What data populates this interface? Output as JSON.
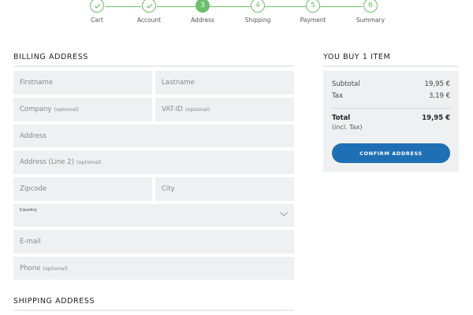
{
  "stepper": {
    "accent_color": "#6cbf6a",
    "steps": [
      {
        "label": "Cart",
        "marker": "",
        "state": "done"
      },
      {
        "label": "Account",
        "marker": "",
        "state": "done"
      },
      {
        "label": "Address",
        "marker": "3",
        "state": "active"
      },
      {
        "label": "Shipping",
        "marker": "4",
        "state": "upcoming"
      },
      {
        "label": "Payment",
        "marker": "5",
        "state": "upcoming"
      },
      {
        "label": "Summary",
        "marker": "6",
        "state": "upcoming"
      }
    ]
  },
  "billing": {
    "title": "BILLING ADDRESS",
    "firstname": {
      "placeholder": "Firstname"
    },
    "lastname": {
      "placeholder": "Lastname"
    },
    "company": {
      "placeholder": "Company",
      "hint": "(optional)"
    },
    "vat_id": {
      "placeholder": "VAT-ID",
      "hint": "(optional)"
    },
    "address": {
      "placeholder": "Address"
    },
    "address2": {
      "placeholder": "Address (Line 2)",
      "hint": "(optional)"
    },
    "zipcode": {
      "placeholder": "Zipcode"
    },
    "city": {
      "placeholder": "City"
    },
    "country": {
      "label": "Country",
      "value": ""
    },
    "email": {
      "placeholder": "E-mail"
    },
    "phone": {
      "placeholder": "Phone",
      "hint": "(optional)"
    }
  },
  "shipping": {
    "title": "SHIPPING ADDRESS"
  },
  "summary": {
    "title": "YOU BUY 1 ITEM",
    "subtotal_label": "Subtotal",
    "subtotal_value": "19,95 €",
    "tax_label": "Tax",
    "tax_value": "3,19 €",
    "total_label": "Total",
    "total_value": "19,95 €",
    "total_note": "(incl. Tax)",
    "confirm_label": "CONFIRM ADDRESS",
    "button_color": "#1f6fb4"
  }
}
